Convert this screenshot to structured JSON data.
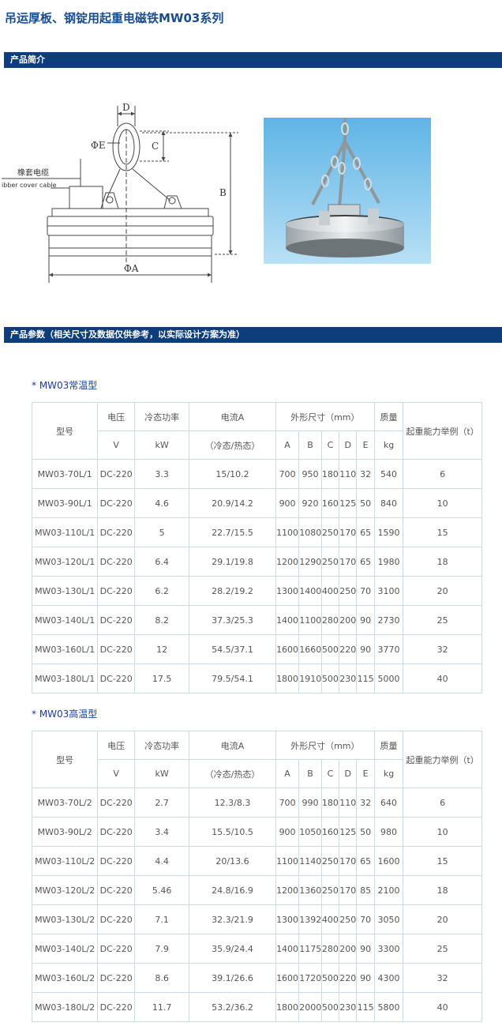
{
  "page": {
    "title": "吊运厚板、钢锭用起重电磁铁MW03系列",
    "section1_label": "产品简介",
    "section2_label": "产品参数（相关尺寸及数据仅供参考，以实际设计方案为准）"
  },
  "diagram": {
    "label_D": "D",
    "label_C": "C",
    "label_B": "B",
    "label_PhiE": "ΦE",
    "label_PhiA": "ΦA",
    "cable_cn": "橡套电缆",
    "cable_en": "ibber cover cable"
  },
  "table_header": {
    "model": "型号",
    "voltage": "电压",
    "voltage_unit": "V",
    "power": "冷态功率",
    "power_unit": "kW",
    "current": "电流A",
    "current_note": "（冷态/热态）",
    "dims": "外形尺寸（mm）",
    "dim_a": "A",
    "dim_b": "B",
    "dim_c": "C",
    "dim_d": "D",
    "dim_e": "E",
    "mass": "质量",
    "mass_unit": "kg",
    "capacity": "起重能力举例（t）"
  },
  "tables": [
    {
      "title": "* MW03常温型",
      "rows": [
        [
          "MW03-70L/1",
          "DC-220",
          "3.3",
          "15/10.2",
          "700",
          "950",
          "180",
          "110",
          "32",
          "540",
          "6"
        ],
        [
          "MW03-90L/1",
          "DC-220",
          "4.6",
          "20.9/14.2",
          "900",
          "920",
          "160",
          "125",
          "50",
          "840",
          "10"
        ],
        [
          "MW03-110L/1",
          "DC-220",
          "5",
          "22.7/15.5",
          "1100",
          "1080",
          "250",
          "170",
          "65",
          "1590",
          "15"
        ],
        [
          "MW03-120L/1",
          "DC-220",
          "6.4",
          "29.1/19.8",
          "1200",
          "1290",
          "250",
          "170",
          "65",
          "1980",
          "18"
        ],
        [
          "MW03-130L/1",
          "DC-220",
          "6.2",
          "28.2/19.2",
          "1300",
          "1400",
          "400",
          "250",
          "70",
          "3100",
          "20"
        ],
        [
          "MW03-140L/1",
          "DC-220",
          "8.2",
          "37.3/25.3",
          "1400",
          "1100",
          "280",
          "200",
          "90",
          "2730",
          "25"
        ],
        [
          "MW03-160L/1",
          "DC-220",
          "12",
          "54.5/37.1",
          "1600",
          "1660",
          "500",
          "220",
          "90",
          "3770",
          "32"
        ],
        [
          "MW03-180L/1",
          "DC-220",
          "17.5",
          "79.5/54.1",
          "1800",
          "1910",
          "500",
          "230",
          "115",
          "5000",
          "40"
        ]
      ]
    },
    {
      "title": "* MW03高温型",
      "rows": [
        [
          "MW03-70L/2",
          "DC-220",
          "2.7",
          "12.3/8.3",
          "700",
          "990",
          "180",
          "110",
          "32",
          "640",
          "6"
        ],
        [
          "MW03-90L/2",
          "DC-220",
          "3.4",
          "15.5/10.5",
          "900",
          "1050",
          "160",
          "125",
          "50",
          "980",
          "10"
        ],
        [
          "MW03-110L/2",
          "DC-220",
          "4.4",
          "20/13.6",
          "1100",
          "1140",
          "250",
          "170",
          "65",
          "1600",
          "15"
        ],
        [
          "MW03-120L/2",
          "DC-220",
          "5.46",
          "24.8/16.9",
          "1200",
          "1360",
          "250",
          "170",
          "85",
          "2100",
          "18"
        ],
        [
          "MW03-130L/2",
          "DC-220",
          "7.1",
          "32.3/21.9",
          "1300",
          "1392",
          "400",
          "250",
          "70",
          "3050",
          "20"
        ],
        [
          "MW03-140L/2",
          "DC-220",
          "7.9",
          "35.9/24.4",
          "1400",
          "1175",
          "280",
          "200",
          "90",
          "3300",
          "25"
        ],
        [
          "MW03-160L/2",
          "DC-220",
          "8.6",
          "39.1/26.6",
          "1600",
          "1720",
          "500",
          "220",
          "90",
          "4300",
          "32"
        ],
        [
          "MW03-180L/2",
          "DC-220",
          "11.7",
          "53.2/36.2",
          "1800",
          "2000",
          "500",
          "230",
          "115",
          "5800",
          "40"
        ]
      ]
    }
  ]
}
